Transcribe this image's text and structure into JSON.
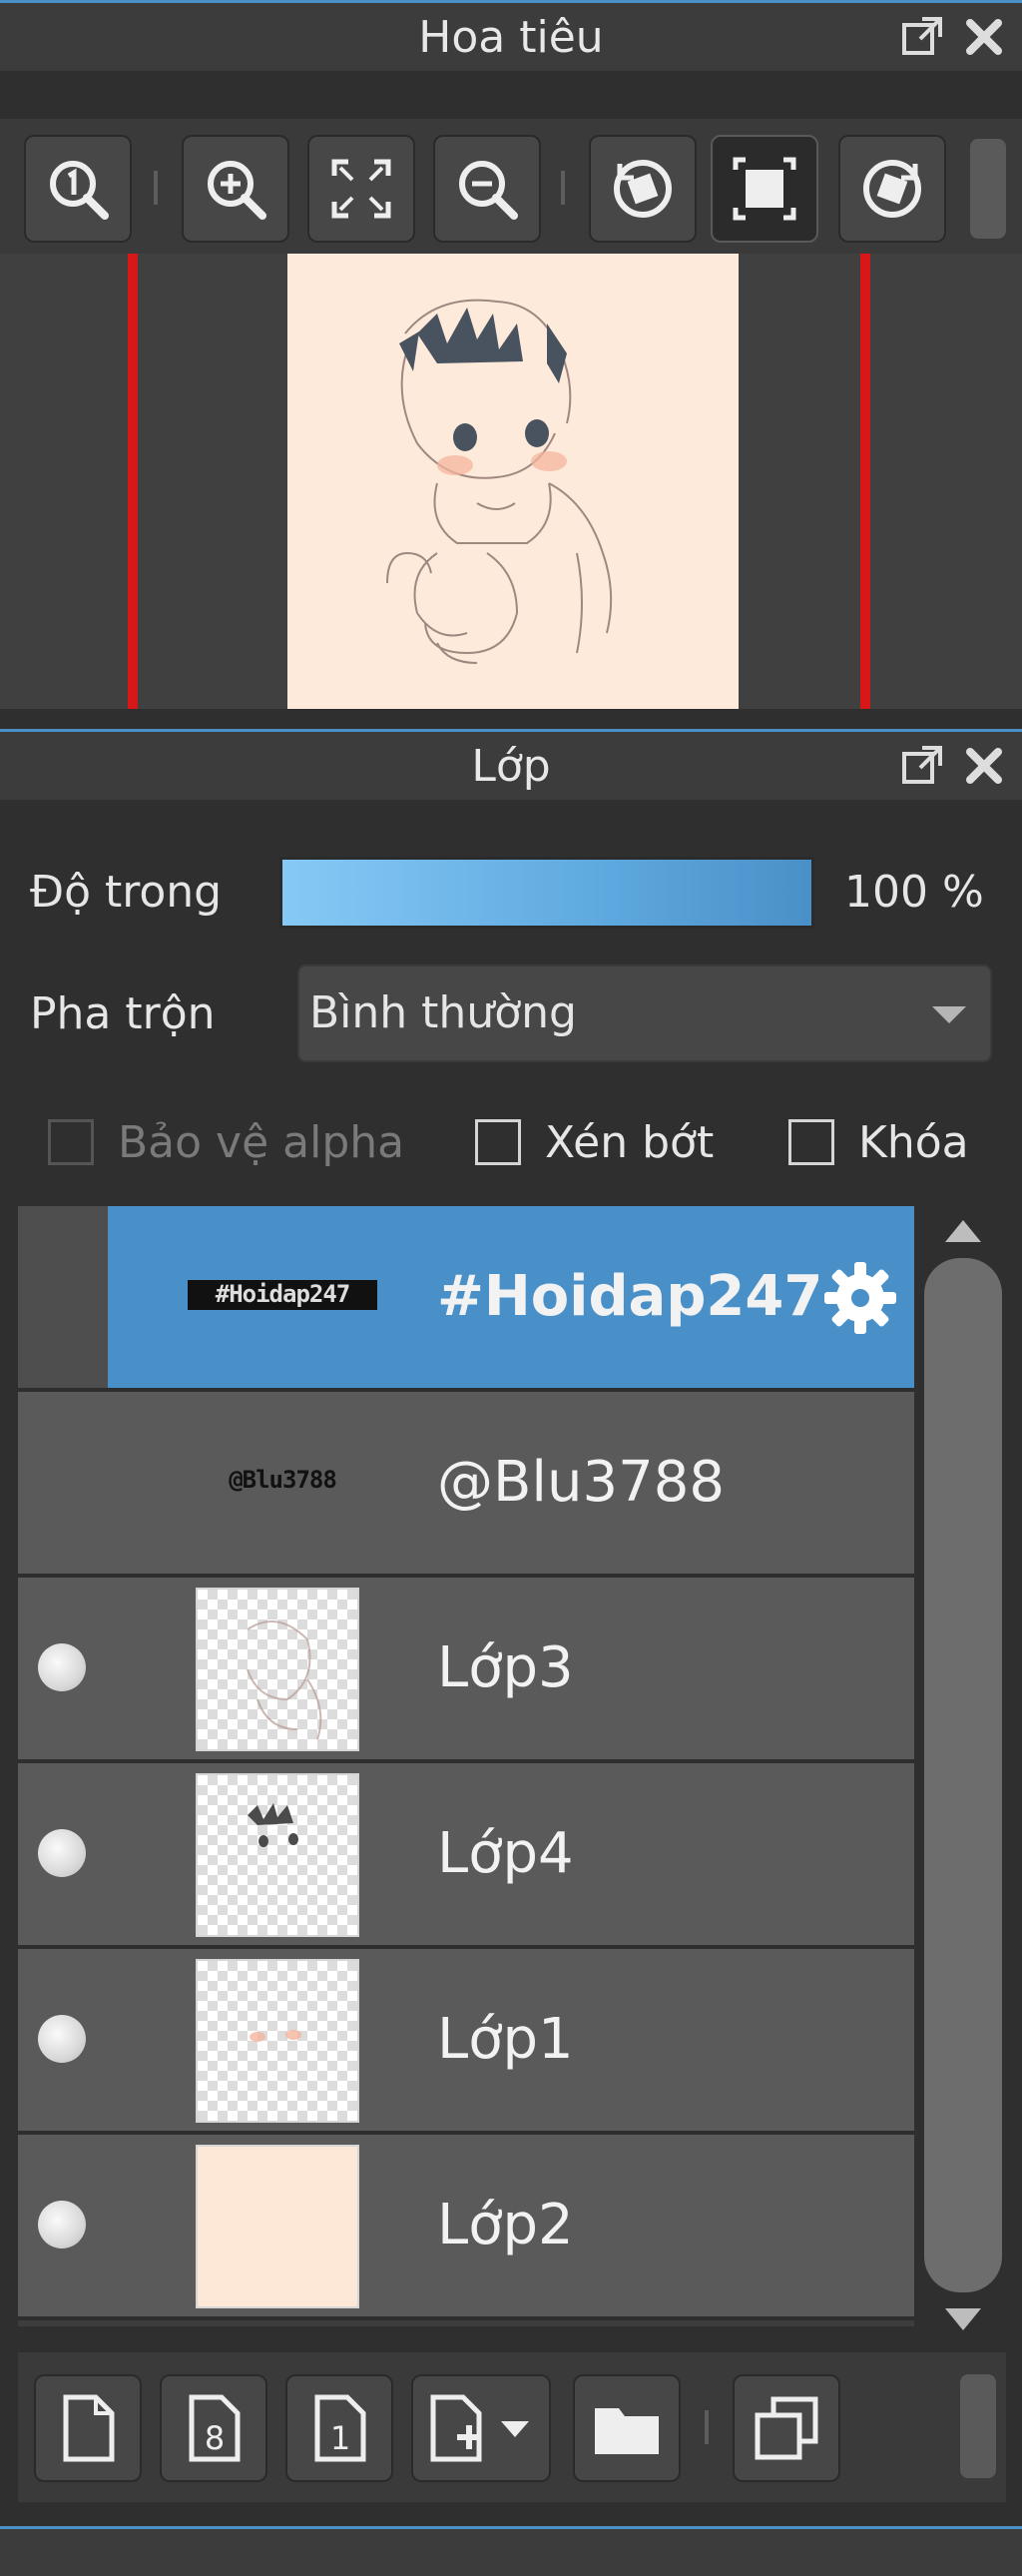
{
  "navigator": {
    "title": "Hoa tiêu",
    "buttons": [
      "zoom-actual-icon",
      "zoom-in-icon",
      "fit-screen-icon",
      "zoom-out-icon",
      "rotate-left-icon",
      "fit-window-icon",
      "rotate-right-icon"
    ]
  },
  "layers": {
    "title": "Lớp",
    "opacity_label": "Độ trong",
    "opacity_value": "100 %",
    "opacity_level": 1.0,
    "blend_label": "Pha trộn",
    "blend_value": "Bình thường",
    "protect_alpha": "Bảo vệ alpha",
    "clipping": "Xén bớt",
    "lock": "Khóa",
    "items": [
      {
        "name": "#Hoidap247",
        "thumb_text": "#Hoidap247",
        "selected": true,
        "visible_dot": false
      },
      {
        "name": "@Blu3788",
        "thumb_text": "@Blu3788",
        "selected": false,
        "visible_dot": false
      },
      {
        "name": "Lớp3",
        "thumb_text": "",
        "selected": false,
        "visible_dot": true
      },
      {
        "name": "Lớp4",
        "thumb_text": "",
        "selected": false,
        "visible_dot": true
      },
      {
        "name": "Lớp1",
        "thumb_text": "",
        "selected": false,
        "visible_dot": true
      },
      {
        "name": "Lớp2",
        "thumb_text": "",
        "selected": false,
        "visible_dot": true
      }
    ]
  },
  "bottom_toolbar": [
    "new-layer-icon",
    "new-layer-8bit-icon",
    "new-layer-1bit-icon",
    "add-layer-menu-icon",
    "folder-icon",
    "duplicate-layer-icon"
  ],
  "colors": {
    "accent": "#4a90c8",
    "canvas": "#fdeadb",
    "frame": "#d81818"
  }
}
